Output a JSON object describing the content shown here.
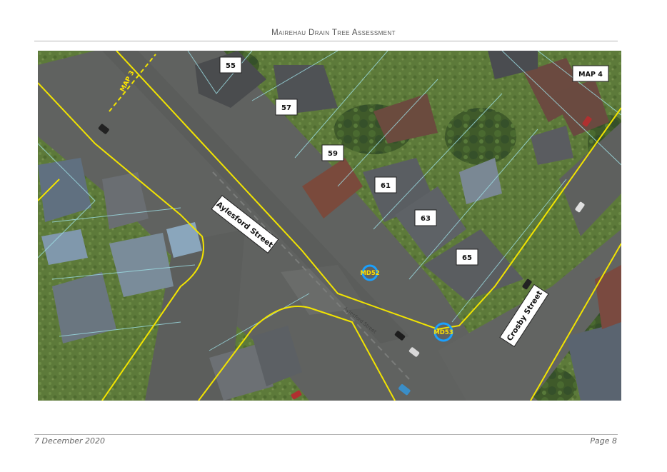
{
  "header": {
    "title": "Mairehau Drain Tree Assessment"
  },
  "footer": {
    "date": "7 December 2020",
    "page": "Page 8"
  },
  "map": {
    "property_labels": [
      {
        "id": "lot-55",
        "text": "55"
      },
      {
        "id": "lot-57",
        "text": "57"
      },
      {
        "id": "lot-59",
        "text": "59"
      },
      {
        "id": "lot-61",
        "text": "61"
      },
      {
        "id": "lot-63",
        "text": "63"
      },
      {
        "id": "lot-65",
        "text": "65"
      }
    ],
    "streets": {
      "aylesford": "Aylesford Street",
      "crosby": "Crosby Street"
    },
    "map_refs": {
      "map3": "MAP 3",
      "map4": "MAP 4"
    },
    "tree_markers": [
      {
        "id": "MD52",
        "text": "MD52"
      },
      {
        "id": "MD53",
        "text": "MD53"
      }
    ],
    "colors": {
      "boundary_yellow": "#f2e400",
      "parcel_cyan": "#9ee0e6",
      "marker_ring": "#1aa0ff",
      "label_bg": "#ffffff"
    }
  }
}
